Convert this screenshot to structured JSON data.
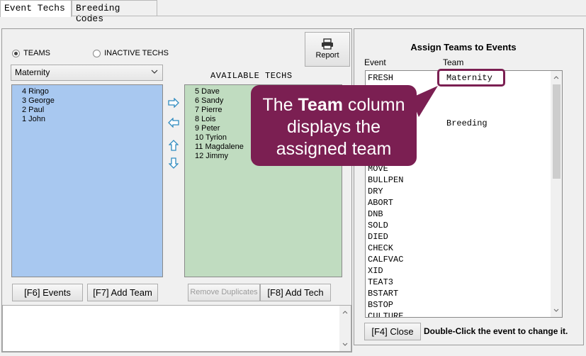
{
  "tabs": [
    "Event Techs",
    "Breeding Codes"
  ],
  "left": {
    "radio_teams": "TEAMS",
    "radio_inactive": "INACTIVE TECHS",
    "team_select": "Maternity",
    "report_label": "Report",
    "available_title": "AVAILABLE TECHS",
    "team_members": [
      "4 Ringo",
      "3 George",
      "2 Paul",
      "1 John"
    ],
    "available_techs": [
      "5 Dave",
      "6 Sandy",
      "7 Pierre",
      "8 Lois",
      "9 Peter",
      "10 Tyrion",
      "11 Magdalene",
      "12 Jimmy"
    ],
    "btn_events": "[F6] Events",
    "btn_add_team": "[F7] Add Team",
    "btn_remove_dup": "Remove Duplicates",
    "btn_add_tech": "[F8] Add Tech"
  },
  "right": {
    "title": "Assign Teams to Events",
    "col_event": "Event",
    "col_team": "Team",
    "rows": [
      {
        "event": "FRESH",
        "team": "Maternity"
      },
      {
        "event": "",
        "team": ""
      },
      {
        "event": "",
        "team": ""
      },
      {
        "event": "",
        "team": ""
      },
      {
        "event": "",
        "team": "Breeding"
      },
      {
        "event": "",
        "team": ""
      },
      {
        "event": "",
        "team": ""
      },
      {
        "event": "",
        "team": ""
      },
      {
        "event": "MOVE",
        "team": ""
      },
      {
        "event": "BULLPEN",
        "team": ""
      },
      {
        "event": "DRY",
        "team": ""
      },
      {
        "event": "ABORT",
        "team": ""
      },
      {
        "event": "DNB",
        "team": ""
      },
      {
        "event": "SOLD",
        "team": ""
      },
      {
        "event": "DIED",
        "team": ""
      },
      {
        "event": "CHECK",
        "team": ""
      },
      {
        "event": "CALFVAC",
        "team": ""
      },
      {
        "event": "XID",
        "team": ""
      },
      {
        "event": "TEAT3",
        "team": ""
      },
      {
        "event": "BSTART",
        "team": ""
      },
      {
        "event": "BSTOP",
        "team": ""
      },
      {
        "event": "CULTURE",
        "team": ""
      }
    ],
    "btn_close": "[F4] Close",
    "hint": "Double-Click the event to change it."
  },
  "callout": {
    "line1_pre": "The ",
    "line1_bold": "Team",
    "line1_post": " column",
    "line2": "displays the",
    "line3": "assigned team"
  },
  "colors": {
    "team_list_bg": "#a8c8f0",
    "avail_list_bg": "#c0dcc0",
    "callout": "#7b1f52",
    "arrow": "#2e8bc0"
  }
}
